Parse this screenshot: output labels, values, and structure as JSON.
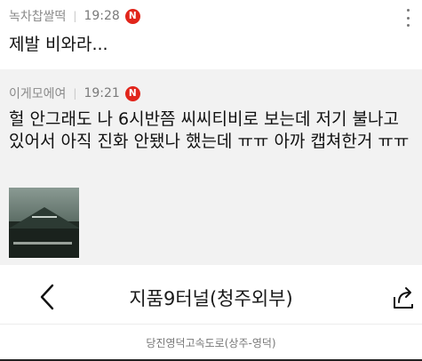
{
  "comments": [
    {
      "author": "녹차찹쌀떡",
      "separator": "|",
      "time": "19:28",
      "badge": "N",
      "body": "제발 비와라..."
    },
    {
      "author": "이게모에여",
      "separator": "|",
      "time": "19:21",
      "badge": "N",
      "body": "헐 안그래도 나 6시반쯤 씨씨티비로 보는데 저기 불나고있어서 아직 진화 안됐나 했는데 ㅠㅠ 아까 캡쳐한거 ㅠㅠ"
    }
  ],
  "cctv_view": {
    "title": "지품9터널(청주외부)",
    "subtitle": "당진영덕고속도로(상주-영덕)"
  },
  "colors": {
    "badge": "#e1251b",
    "comment_bg_alt": "#f2f2f2"
  },
  "icons": {
    "menu": "kebab-vertical-icon",
    "back": "chevron-left-icon",
    "share": "share-icon"
  }
}
